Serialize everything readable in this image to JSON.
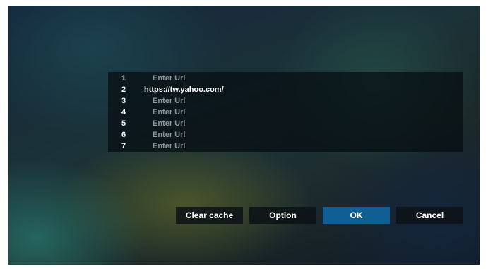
{
  "url_list": {
    "rows": [
      {
        "index": "1",
        "value": "Enter Url",
        "is_placeholder": true
      },
      {
        "index": "2",
        "value": "https://tw.yahoo.com/",
        "is_placeholder": false
      },
      {
        "index": "3",
        "value": "Enter Url",
        "is_placeholder": true
      },
      {
        "index": "4",
        "value": "Enter Url",
        "is_placeholder": true
      },
      {
        "index": "5",
        "value": "Enter Url",
        "is_placeholder": true
      },
      {
        "index": "6",
        "value": "Enter Url",
        "is_placeholder": true
      },
      {
        "index": "7",
        "value": "Enter Url",
        "is_placeholder": true
      }
    ]
  },
  "buttons": {
    "clear_cache": "Clear cache",
    "option": "Option",
    "ok": "OK",
    "cancel": "Cancel",
    "focused": "ok"
  },
  "colors": {
    "focused_button": "#0f5f95",
    "placeholder_text": "#8a949a",
    "text": "#ffffff"
  }
}
